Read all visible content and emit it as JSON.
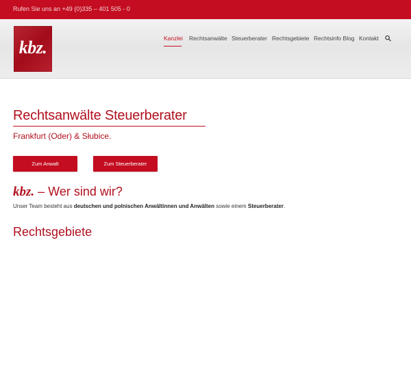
{
  "topbar": {
    "phone_text": "Rufen Sie uns an +49 (0)335 – 401 505 - 0"
  },
  "logo": {
    "text": "kbz."
  },
  "nav": {
    "items": [
      {
        "label": "Kanzlei",
        "active": true
      },
      {
        "label": "Rechtsanwälte"
      },
      {
        "label": "Steuerberater"
      },
      {
        "label": "Rechtsgebiete"
      },
      {
        "label": "Rechtsinfo Blog"
      },
      {
        "label": "Kontakt"
      }
    ],
    "search_icon": "search-icon"
  },
  "hero": {
    "title": "Rechtsanwälte Steuerberater",
    "subtitle": "Frankfurt (Oder) & Słubice."
  },
  "buttons": {
    "anwalt_label": "Zum Anwalt",
    "steuer_label": "Zum Steuerberater"
  },
  "who": {
    "brand": "kbz.",
    "heading": "– Wer sind wir?",
    "team_prefix": "Unser Team besteht aus ",
    "team_bold": "deutschen und polnischen Anwältinnen und Anwälten",
    "team_middle": " sowie einem ",
    "team_bold2": "Steuerberater",
    "team_suffix": "."
  },
  "sections": {
    "rechtsgebiete_title": "Rechtsgebiete"
  },
  "colors": {
    "brand_red": "#c40d20",
    "text_red": "#b0101e"
  }
}
